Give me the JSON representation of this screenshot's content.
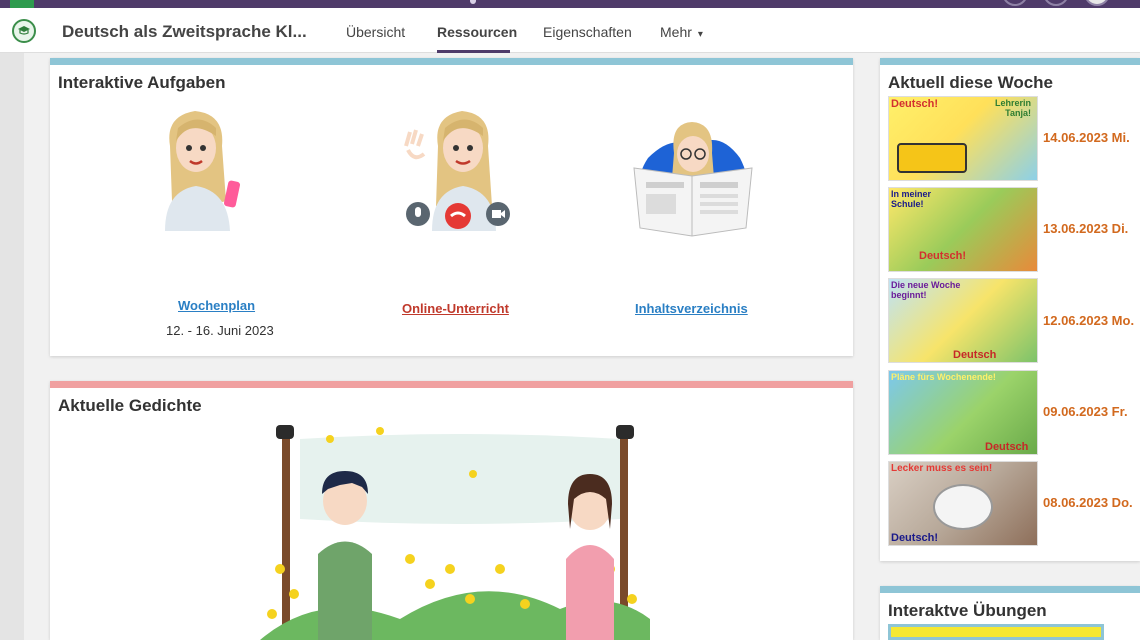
{
  "header": {
    "course_title": "Deutsch als Zweitsprache Kl...",
    "tabs": [
      {
        "label": "Übersicht"
      },
      {
        "label": "Ressourcen"
      },
      {
        "label": "Eigenschaften"
      },
      {
        "label": "Mehr"
      }
    ],
    "active_tab": "Ressourcen",
    "more_caret": "▾"
  },
  "interactive_tasks": {
    "title": "Interaktive Aufgaben",
    "accent": "#8ec5d6",
    "items": [
      {
        "label": "Wochenplan",
        "subtitle": "12. - 16. Juni 2023",
        "link_color": "#2a7fc4"
      },
      {
        "label": "Online-Unterricht",
        "link_color": "#c0392b"
      },
      {
        "label": "Inhaltsverzeichnis",
        "link_color": "#2a7fc4"
      }
    ]
  },
  "poems": {
    "title": "Aktuelle Gedichte",
    "accent": "#f0a0a0"
  },
  "this_week": {
    "title": "Aktuell diese Woche",
    "accent": "#8ec5d6",
    "items": [
      {
        "date": "14.06.2023 Mi.",
        "caption": "Deutsch!",
        "subcaption": "Lehrerin Tanja!"
      },
      {
        "date": "13.06.2023 Di.",
        "caption": "In meiner Schule!",
        "subcaption": "Deutsch!"
      },
      {
        "date": "12.06.2023 Mo.",
        "caption": "Die neue Woche beginnt!",
        "subcaption": "Deutsch"
      },
      {
        "date": "09.06.2023 Fr.",
        "caption": "Pläne fürs Wochenende!",
        "subcaption": "Deutsch"
      },
      {
        "date": "08.06.2023 Do.",
        "caption": "Lecker muss es sein!",
        "subcaption": "Deutsch!"
      }
    ]
  },
  "exercises": {
    "title": "Interaktve Übungen",
    "accent": "#8ec5d6"
  },
  "colors": {
    "brand_purple": "#4f3b6a",
    "date_orange": "#d2691e"
  }
}
